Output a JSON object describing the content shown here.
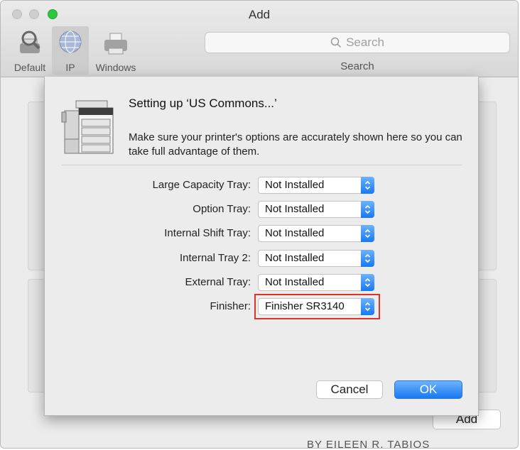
{
  "window": {
    "title": "Add"
  },
  "toolbar": {
    "default_label": "Default",
    "ip_label": "IP",
    "windows_label": "Windows",
    "search_placeholder": "Search",
    "search_caption": "Search"
  },
  "background": {
    "add_button_label": "Add",
    "footer_text": "BY EILEEN R. TABIOS"
  },
  "sheet": {
    "title": "Setting up ‘US Commons...’",
    "description": "Make sure your printer's options are accurately shown here so you can take full advantage of them.",
    "options": [
      {
        "label": "Large Capacity Tray:",
        "value": "Not Installed"
      },
      {
        "label": "Option Tray:",
        "value": "Not Installed"
      },
      {
        "label": "Internal Shift Tray:",
        "value": "Not Installed"
      },
      {
        "label": "Internal Tray 2:",
        "value": "Not Installed"
      },
      {
        "label": "External Tray:",
        "value": "Not Installed"
      },
      {
        "label": "Finisher:",
        "value": "Finisher SR3140"
      }
    ],
    "cancel_label": "Cancel",
    "ok_label": "OK"
  },
  "colors": {
    "accent": "#1878f3",
    "highlight": "#e0322d",
    "zoom_button": "#2bc840"
  },
  "icons": [
    "search-icon",
    "default-printer-icon",
    "ip-globe-icon",
    "windows-printer-icon",
    "printer-image",
    "chevron-up-down-icon"
  ]
}
